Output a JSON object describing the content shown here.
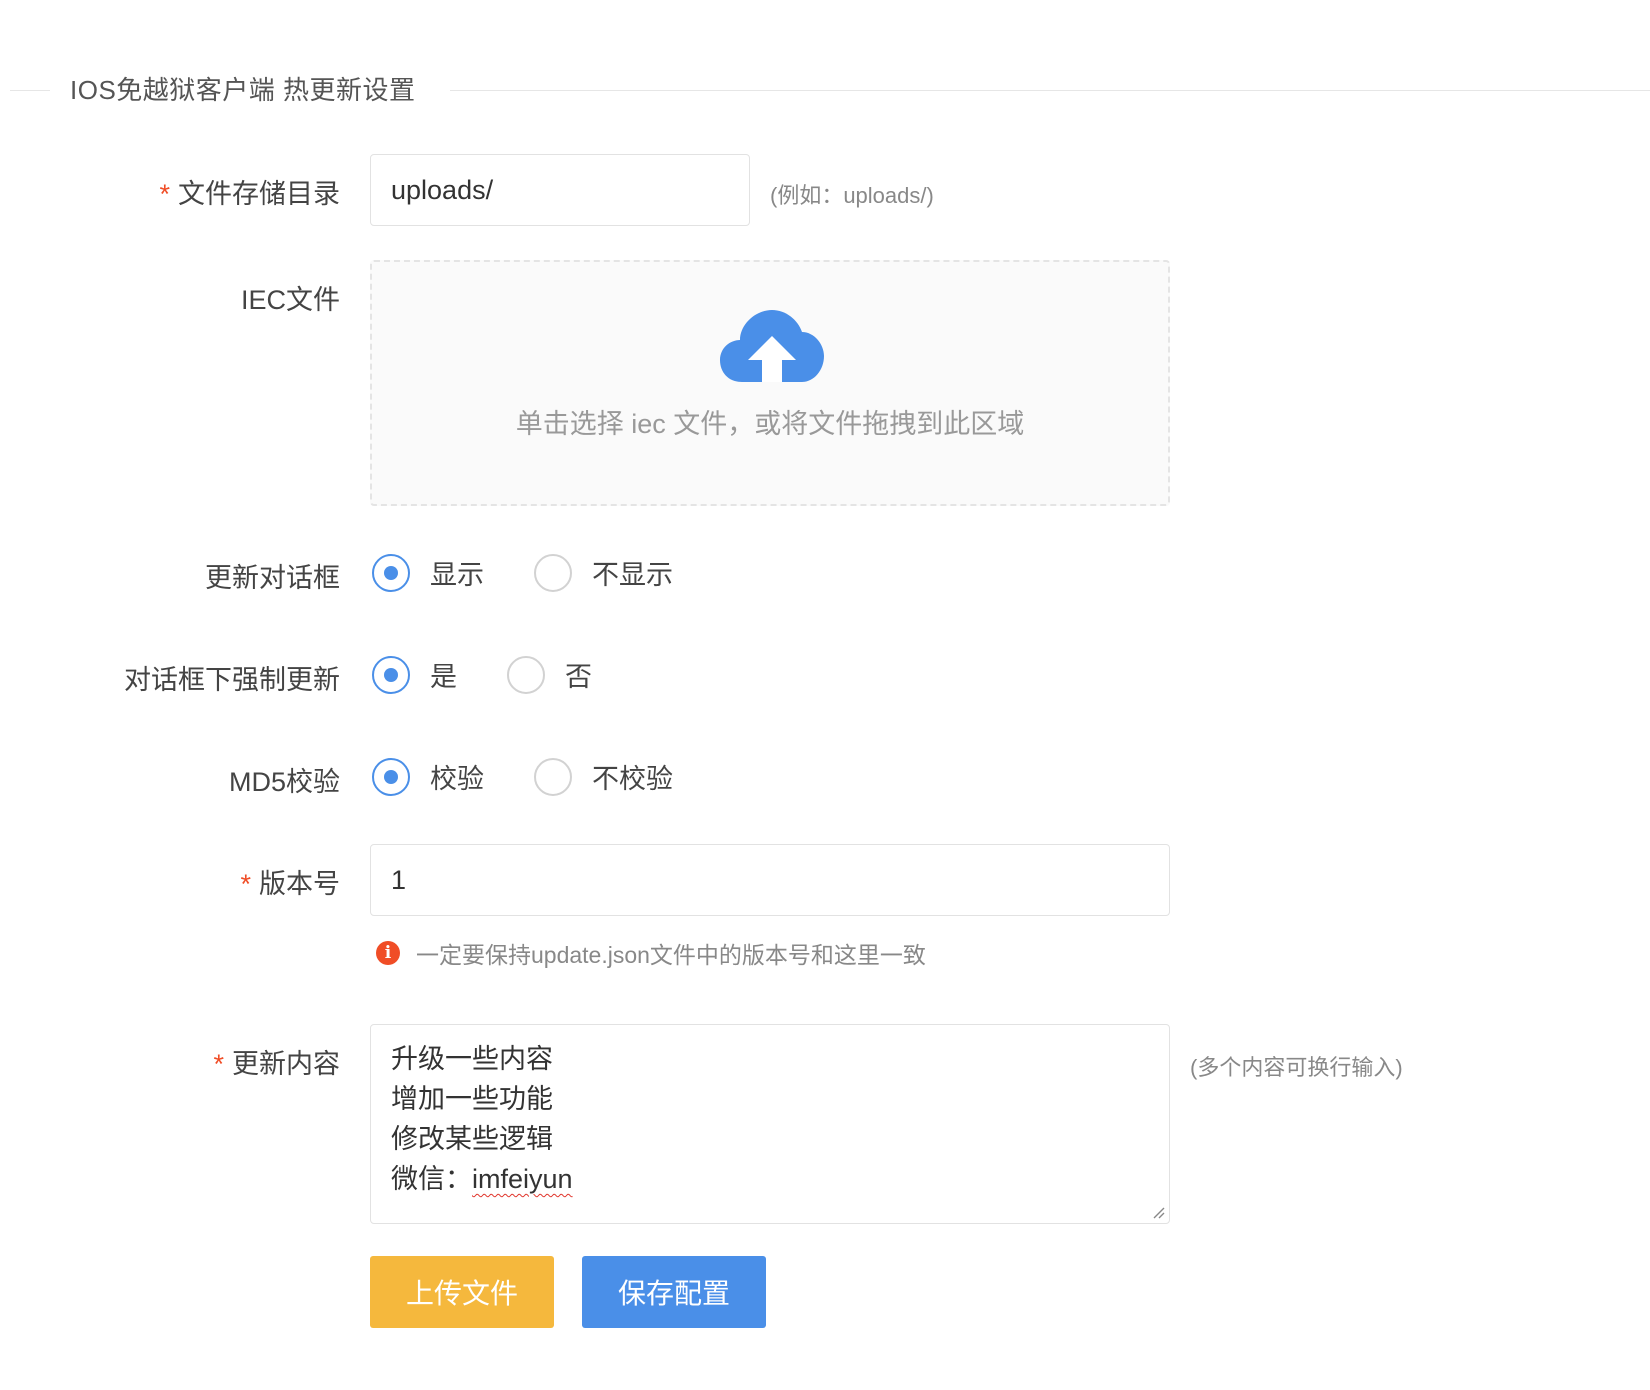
{
  "section": {
    "title": "IOS免越狱客户端 热更新设置"
  },
  "colors": {
    "primary": "#4a8fe8",
    "warning": "#f5b83d",
    "danger": "#f04d26"
  },
  "fields": {
    "storage_dir": {
      "required_mark": "*",
      "label": "文件存储目录",
      "value": "uploads/",
      "aux": "(例如：uploads/)"
    },
    "iec_file": {
      "label": "IEC文件",
      "icon": "cloud-upload-icon",
      "hint": "单击选择 iec 文件，或将文件拖拽到此区域"
    },
    "update_dialog": {
      "label": "更新对话框",
      "options": [
        {
          "label": "显示",
          "checked": true
        },
        {
          "label": "不显示",
          "checked": false
        }
      ]
    },
    "force_update": {
      "label": "对话框下强制更新",
      "options": [
        {
          "label": "是",
          "checked": true
        },
        {
          "label": "否",
          "checked": false
        }
      ]
    },
    "md5_check": {
      "label": "MD5校验",
      "options": [
        {
          "label": "校验",
          "checked": true
        },
        {
          "label": "不校验",
          "checked": false
        }
      ]
    },
    "version": {
      "required_mark": "*",
      "label": "版本号",
      "value": "1",
      "tip_icon": "info-icon",
      "tip": "一定要保持update.json文件中的版本号和这里一致"
    },
    "update_content": {
      "required_mark": "*",
      "label": "更新内容",
      "lines": [
        "升级一些内容",
        "增加一些功能",
        "修改某些逻辑"
      ],
      "last_line_prefix": "微信：",
      "last_line_value": "imfeiyun",
      "aux": "(多个内容可换行输入)"
    }
  },
  "buttons": {
    "upload": "上传文件",
    "save": "保存配置"
  }
}
